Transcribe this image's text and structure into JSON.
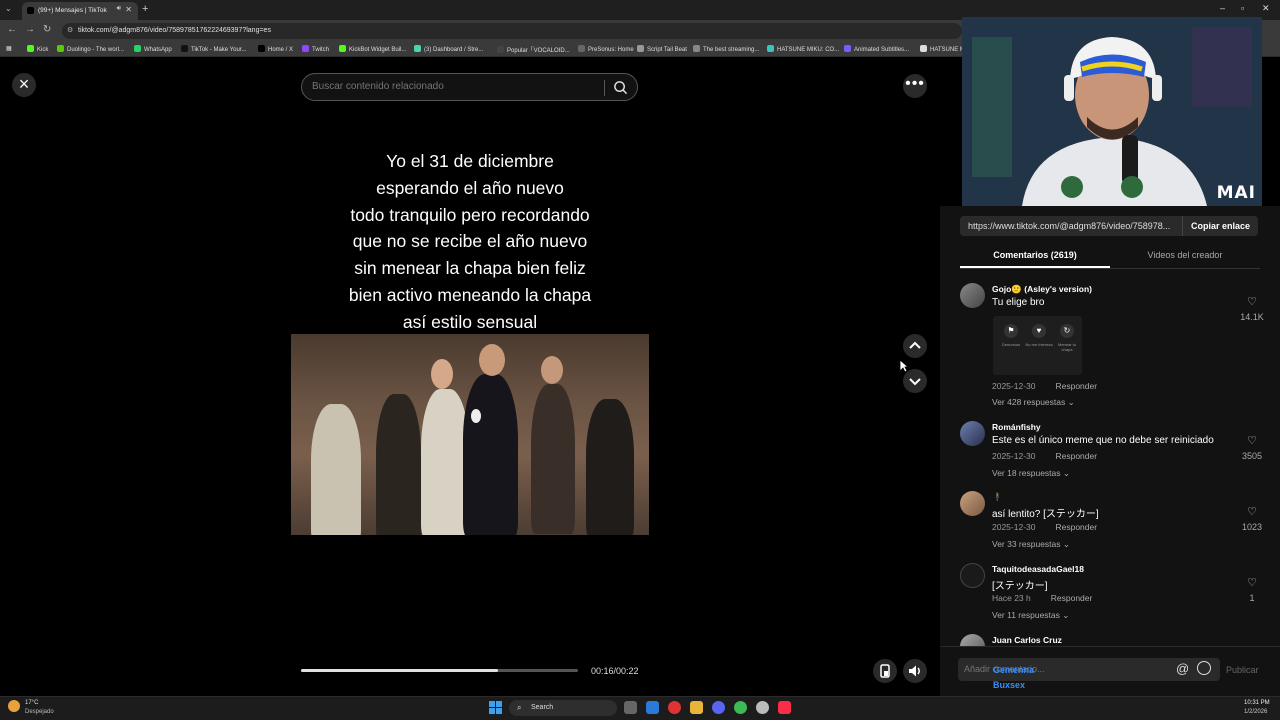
{
  "browser": {
    "tab_title": "(99+) Mensajes | TikTok",
    "url": "tiktok.com/@adgm876/video/7589785176222469397?lang=es",
    "bookmarks": [
      {
        "label": "Kick",
        "color": "#53fc18"
      },
      {
        "label": "Duolingo - The worl...",
        "color": "#58cc02"
      },
      {
        "label": "WhatsApp",
        "color": "#25d366"
      },
      {
        "label": "TikTok - Make Your...",
        "color": "#111111"
      },
      {
        "label": "Home / X",
        "color": "#000000"
      },
      {
        "label": "Twitch",
        "color": "#9146ff"
      },
      {
        "label": "KickBot Widget Buil...",
        "color": "#53fc18"
      },
      {
        "label": "(3) Dashboard / Stre...",
        "color": "#4cd4b0"
      },
      {
        "label": "Popular「VOCALOID...",
        "color": "#444444"
      },
      {
        "label": "PreSonus: Home",
        "color": "#666666"
      },
      {
        "label": "Script Tail Beat",
        "color": "#999999"
      },
      {
        "label": "The best streaming...",
        "color": "#888888"
      },
      {
        "label": "HATSUNE MIKU: CO...",
        "color": "#39c5bb"
      },
      {
        "label": "Animated Subtitles...",
        "color": "#7a5cff"
      },
      {
        "label": "HATSUNE M",
        "color": "#dddddd"
      }
    ]
  },
  "player": {
    "search_placeholder": "Buscar contenido relacionado",
    "caption_lines": [
      "Yo el 31 de diciembre",
      "esperando el año nuevo",
      "todo tranquilo pero recordando",
      "que no se recibe el año nuevo",
      "sin menear la chapa bien feliz",
      "bien activo meneando la chapa",
      "así estilo sensual"
    ],
    "time_display": "00:16/00:22",
    "progress": 0.71
  },
  "webcam": {
    "label": "MAI"
  },
  "side": {
    "share_url": "https://www.tiktok.com/@adgm876/video/758978...",
    "copy_label": "Copiar enlace",
    "tabs": [
      "Comentarios (2619)",
      "Videos del creador"
    ],
    "reply_label": "Responder",
    "comments": [
      {
        "user": "Gojo🙂 (Asley's version)",
        "text": "Tu elige bro",
        "date": "2025-12-30",
        "replies": "Ver 428 respuestas",
        "likes": "14.1K"
      },
      {
        "user": "Románfishy",
        "text": "Este es el único meme que no debe ser reiniciado",
        "date": "2025-12-30",
        "replies": "Ver 18 respuestas",
        "likes": "3505"
      },
      {
        "user": "🕴",
        "text": "así lentito? [ステッカー]",
        "date": "2025-12-30",
        "replies": "Ver 33 respuestas",
        "likes": "1023"
      },
      {
        "user": "TaquitodeasadaGael18",
        "text": "[ステッカー]",
        "date": "Hace 23 h",
        "replies": "Ver 11 respuestas",
        "likes": "1"
      },
      {
        "user": "Juan Carlos Cruz",
        "text": "",
        "date": "",
        "replies": "",
        "likes": ""
      }
    ],
    "sticker_actions": [
      {
        "icon": "⚑",
        "label": "Denunciar"
      },
      {
        "icon": "♥",
        "label": "No me interesa"
      },
      {
        "icon": "↻",
        "label": "Menear tu chapa"
      }
    ],
    "comment_placeholder": "Añadir comentario...",
    "mention_symbol": "@",
    "publish_label": "Publicar",
    "chat_overlay": [
      "Gemenna",
      "Buxsex"
    ]
  },
  "taskbar": {
    "temp": "17°C",
    "weather": "Despejado",
    "search_label": "Search",
    "time": "10:31 PM",
    "date": "1/2/2026"
  }
}
